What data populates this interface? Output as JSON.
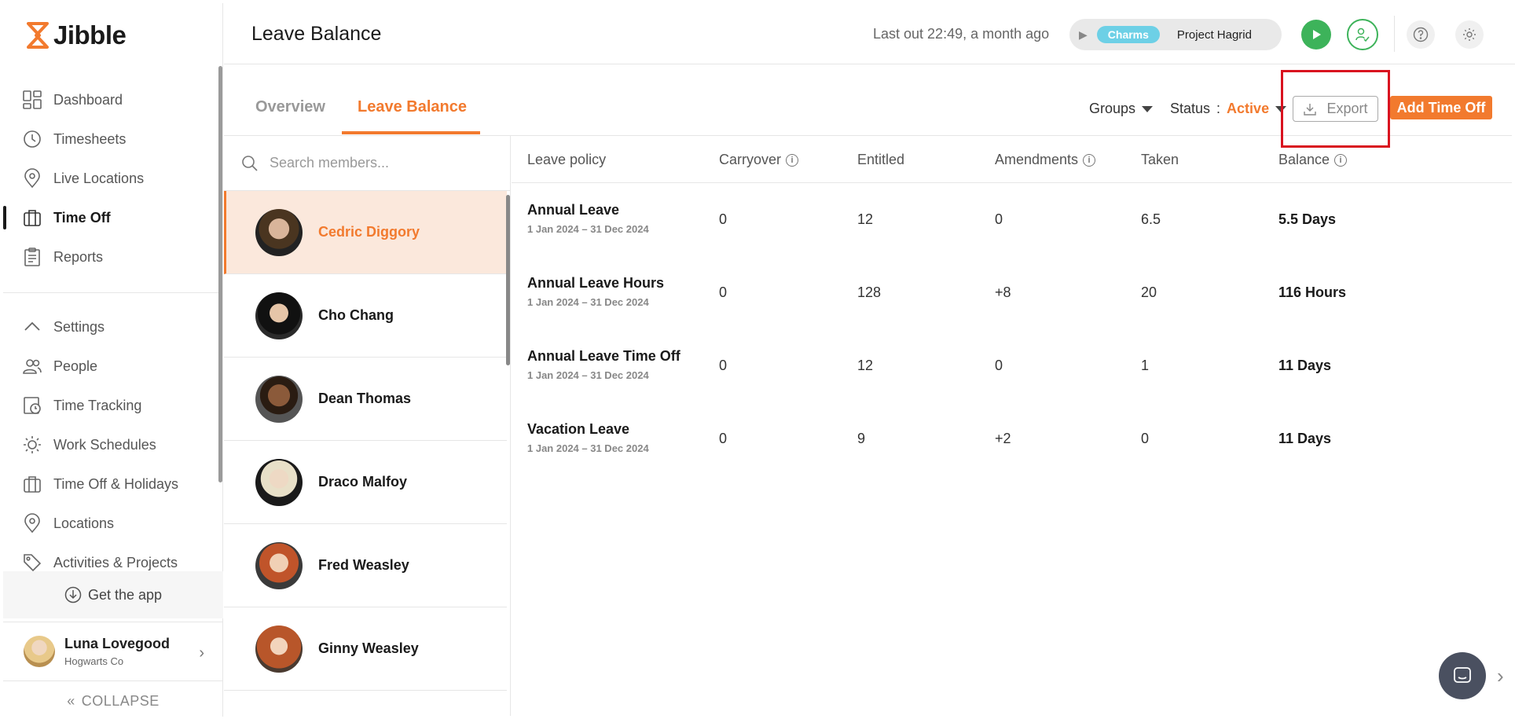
{
  "app": {
    "name": "Jibble"
  },
  "sidebar": {
    "items": [
      {
        "label": "Dashboard",
        "icon": "dashboard-icon"
      },
      {
        "label": "Timesheets",
        "icon": "clock-icon"
      },
      {
        "label": "Live Locations",
        "icon": "location-pin-icon"
      },
      {
        "label": "Time Off",
        "icon": "briefcase-icon",
        "active": true
      },
      {
        "label": "Reports",
        "icon": "clipboard-icon"
      }
    ],
    "settings_items": [
      {
        "label": "Settings",
        "icon": "chevron-up-icon"
      },
      {
        "label": "People",
        "icon": "people-icon"
      },
      {
        "label": "Time Tracking",
        "icon": "time-tracking-icon"
      },
      {
        "label": "Work Schedules",
        "icon": "sun-icon"
      },
      {
        "label": "Time Off & Holidays",
        "icon": "briefcase-icon"
      },
      {
        "label": "Locations",
        "icon": "location-pin-icon"
      },
      {
        "label": "Activities & Projects",
        "icon": "tag-icon"
      }
    ],
    "get_app": "Get the app",
    "user": {
      "name": "Luna Lovegood",
      "org": "Hogwarts Co"
    },
    "collapse": "COLLAPSE"
  },
  "header": {
    "title": "Leave Balance",
    "last_out": "Last out 22:49, a month ago",
    "activity_badge": "Charms",
    "project": "Project Hagrid"
  },
  "tabs": [
    {
      "label": "Overview",
      "active": false
    },
    {
      "label": "Leave Balance",
      "active": true
    }
  ],
  "filters": {
    "groups": "Groups",
    "status_label": "Status",
    "status_value": "Active",
    "export": "Export",
    "add_time_off": "Add Time Off"
  },
  "search": {
    "placeholder": "Search members..."
  },
  "members": [
    {
      "name": "Cedric Diggory",
      "selected": true
    },
    {
      "name": "Cho Chang"
    },
    {
      "name": "Dean Thomas"
    },
    {
      "name": "Draco Malfoy"
    },
    {
      "name": "Fred Weasley"
    },
    {
      "name": "Ginny Weasley"
    }
  ],
  "table": {
    "headers": [
      "Leave policy",
      "Carryover",
      "Entitled",
      "Amendments",
      "Taken",
      "Balance"
    ],
    "rows": [
      {
        "policy": "Annual Leave",
        "dates": "1 Jan 2024 – 31 Dec 2024",
        "carryover": "0",
        "entitled": "12",
        "amendments": "0",
        "taken": "6.5",
        "balance": "5.5 Days"
      },
      {
        "policy": "Annual Leave Hours",
        "dates": "1 Jan 2024 – 31 Dec 2024",
        "carryover": "0",
        "entitled": "128",
        "amendments": "+8",
        "taken": "20",
        "balance": "116 Hours"
      },
      {
        "policy": "Annual Leave Time Off",
        "dates": "1 Jan 2024 – 31 Dec 2024",
        "carryover": "0",
        "entitled": "12",
        "amendments": "0",
        "taken": "1",
        "balance": "11 Days"
      },
      {
        "policy": "Vacation Leave",
        "dates": "1 Jan 2024 – 31 Dec 2024",
        "carryover": "0",
        "entitled": "9",
        "amendments": "+2",
        "taken": "0",
        "balance": "11 Days"
      }
    ]
  },
  "colors": {
    "accent": "#f27a2e",
    "green": "#3db35a",
    "badge": "#6dd0e6",
    "highlight": "#d9121f"
  }
}
